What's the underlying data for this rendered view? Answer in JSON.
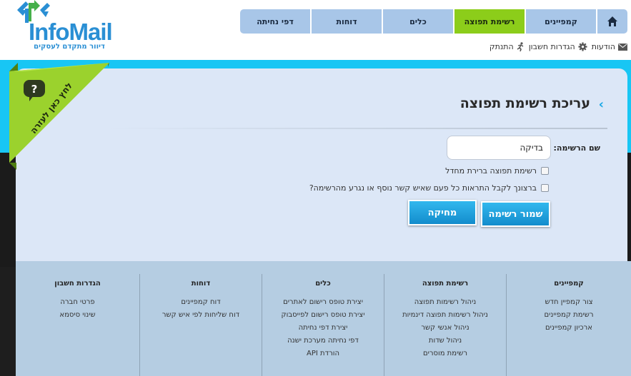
{
  "brand": {
    "name_part1": "Info",
    "name_part2": "Mail",
    "tagline": "דיוור מתקדם לעסקים"
  },
  "nav": {
    "home_icon": "home-icon",
    "tabs": [
      {
        "label": "קמפיינים",
        "active": false
      },
      {
        "label": "רשימת תפוצה",
        "active": true
      },
      {
        "label": "כלים",
        "active": false
      },
      {
        "label": "דוחות",
        "active": false
      },
      {
        "label": "דפי נחיתה",
        "active": false
      }
    ]
  },
  "util_links": {
    "messages": "הודעות",
    "account_settings": "הגדרות חשבון",
    "logout": "התנתק"
  },
  "help_ribbon": {
    "label": "לחץ כאן לעזרה",
    "icon": "question-bubble-icon"
  },
  "page": {
    "title": "עריכת רשימת תפוצה",
    "list_name_label": "שם הרשימה:",
    "list_name_value": "בדיקה",
    "checkbox_default_list": "רשימת תפוצה ברירת מחדל",
    "checkbox_notify": "ברצונך לקבל התראות כל פעם שאיש קשר נוסף או נגרע מהרשימה?",
    "save_button": "שמור רשימה",
    "delete_button": "מחיקה"
  },
  "footer": {
    "columns": [
      {
        "title": "קמפיינים",
        "links": [
          "צור קמפיין חדש",
          "רשימת קמפיינים",
          "ארכיון קמפיינים"
        ]
      },
      {
        "title": "רשימת תפוצה",
        "links": [
          "ניהול רשימות תפוצה",
          "ניהול רשימות תפוצה דינמיות",
          "ניהול אנשי קשר",
          "ניהול שדות",
          "רשימת מוסרים"
        ]
      },
      {
        "title": "כלים",
        "links": [
          "יצירת טופס רישום לאתרים",
          "יצירת טופס רישום לפייסבוק",
          "יצירת דפי נחיתה",
          "דפי נחיתה מערכת ישנה",
          "הורדת API"
        ]
      },
      {
        "title": "דוחות",
        "links": [
          "דוח קמפיינים",
          "דוח שליחות לפי איש קשר"
        ]
      },
      {
        "title": "הגדרות חשבון",
        "links": [
          "פרטי חברה",
          "שינוי סיסמא"
        ]
      }
    ]
  },
  "colors": {
    "accent_blue": "#18c6f4",
    "nav_tab": "#a8c6e8",
    "nav_active": "#8ccd1a",
    "panel": "#dce7f7",
    "footer": "#b5cde2",
    "button": "#1aa3e0"
  }
}
